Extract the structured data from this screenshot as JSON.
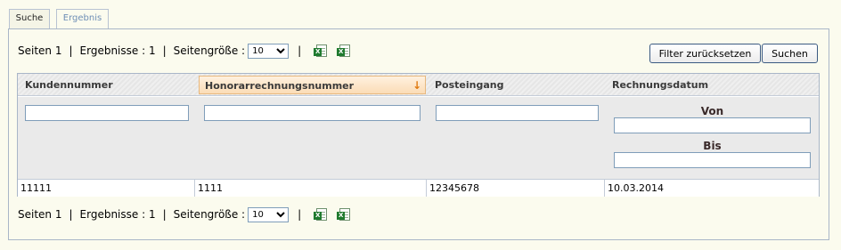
{
  "tabs": [
    {
      "label": "Suche"
    },
    {
      "label": "Ergebnis"
    }
  ],
  "pager": {
    "pages_text": "Seiten 1",
    "sep": "|",
    "results_text": "Ergebnisse : 1",
    "page_size_label": "Seitengröße :",
    "page_size_value": "10",
    "page_size_options": [
      "10"
    ]
  },
  "buttons": {
    "reset_filter": "Filter zurücksetzen",
    "search": "Suchen"
  },
  "grid": {
    "columns": [
      {
        "label": "Kundennummer"
      },
      {
        "label": "Honorarrechnungsnummer",
        "sort_indicator": "↓"
      },
      {
        "label": "Posteingang"
      },
      {
        "label": "Rechnungsdatum"
      }
    ],
    "date_filter": {
      "from_label": "Von",
      "to_label": "Bis"
    },
    "rows": [
      [
        "11111",
        "1111",
        "12345678",
        "10.03.2014"
      ]
    ]
  },
  "icons": {
    "export": "excel-export-icon",
    "export_alt": "excel-sheet-icon"
  },
  "colors": {
    "background": "#fbfbee",
    "border": "#a9b6c8",
    "sort_highlight": "#fbdcb6",
    "sort_arrow": "#e07a10"
  }
}
